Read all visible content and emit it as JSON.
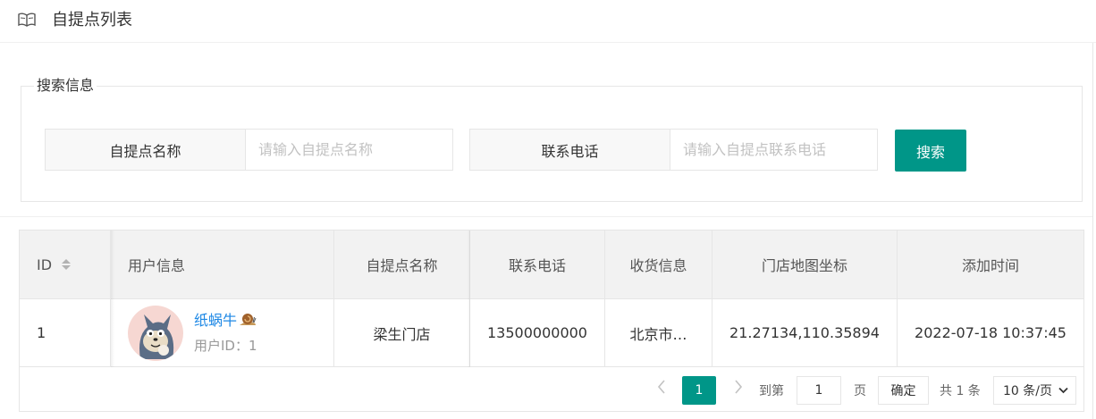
{
  "header": {
    "title": "自提点列表",
    "icon": "book-icon"
  },
  "search": {
    "legend": "搜索信息",
    "name_label": "自提点名称",
    "name_placeholder": "请输入自提点名称",
    "name_value": "",
    "phone_label": "联系电话",
    "phone_placeholder": "请输入自提点联系电话",
    "phone_value": "",
    "button_label": "搜索"
  },
  "table": {
    "columns": [
      "ID",
      "用户信息",
      "自提点名称",
      "联系电话",
      "收货信息",
      "门店地图坐标",
      "添加时间"
    ],
    "rows": [
      {
        "id": "1",
        "nickname": "纸蜗牛",
        "user_id_text": "用户ID：1",
        "name": "梁生门店",
        "phone": "13500000000",
        "address": "北京市…",
        "coords": "21.27134,110.35894",
        "added_time": "2022-07-18 10:37:45"
      }
    ]
  },
  "pagination": {
    "current_page": "1",
    "goto_label": "到第",
    "goto_value": "1",
    "page_label": "页",
    "confirm_label": "确定",
    "total_text": "共 1 条",
    "page_size": "10 条/页"
  },
  "colors": {
    "primary": "#009688",
    "link": "#1e88e5",
    "header_bg": "#f2f2f2"
  }
}
